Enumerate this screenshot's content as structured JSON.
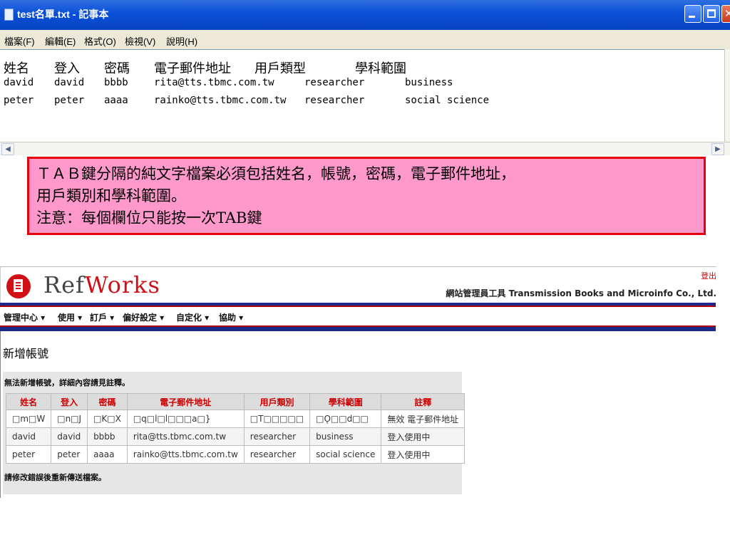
{
  "notepad": {
    "title": "test名單.txt - 記事本",
    "menu": [
      "檔案(F)",
      "編輯(E)",
      "格式(O)",
      "檢視(V)",
      "說明(H)"
    ],
    "headers": [
      "姓名",
      "登入",
      "密碼",
      "電子郵件地址",
      "用戶類型",
      "學科範圍"
    ],
    "rows": [
      [
        "david",
        "david",
        "bbbb",
        "rita@tts.tbmc.com.tw",
        "researcher",
        "business"
      ],
      [
        "peter",
        "peter",
        "aaaa",
        "rainko@tts.tbmc.com.tw",
        "researcher",
        "social science"
      ]
    ]
  },
  "note": {
    "line1": "ＴＡＢ鍵分隔的純文字檔案必須包括姓名，帳號，密碼，電子郵件地址，",
    "line2": "用戶類別和學科範圍。",
    "line3": "注意：每個欄位只能按一次TAB鍵"
  },
  "refworks": {
    "logo_prefix": "Ref",
    "logo_accent": "Works",
    "logout": "登出",
    "admin_title": "網站管理員工具 Transmission Books and Microinfo Co., Ltd.",
    "nav": [
      "管理中心 ▾",
      "使用 ▾",
      "訂戶 ▾",
      "偏好設定 ▾",
      "自定化 ▾",
      "協助 ▾"
    ],
    "page_title": "新增帳號",
    "error_msg": "無法新增帳號，詳細內容請見註釋。",
    "fix_msg": "請修改錯誤後重新傳送檔案。",
    "table": {
      "headers": [
        "姓名",
        "登入",
        "密碼",
        "電子郵件地址",
        "用戶類別",
        "學科範圍",
        "註釋"
      ],
      "rows": [
        [
          "□m□W",
          "□n□J",
          "□K□X",
          "□q□l□l□□□a□}",
          "□T□□□□□",
          "□Ǫ□□d□□",
          "無效 電子郵件地址"
        ],
        [
          "david",
          "david",
          "bbbb",
          "rita@tts.tbmc.com.tw",
          "researcher",
          "business",
          "登入使用中"
        ],
        [
          "peter",
          "peter",
          "aaaa",
          "rainko@tts.tbmc.com.tw",
          "researcher",
          "social science",
          "登入使用中"
        ]
      ]
    }
  },
  "colors": {
    "xp_title_blue": "#0a4fd8",
    "note_pink": "#ff99cc",
    "note_border": "#e8000b",
    "brand_red": "#d10f16",
    "brand_navy": "#1a2a8a"
  }
}
